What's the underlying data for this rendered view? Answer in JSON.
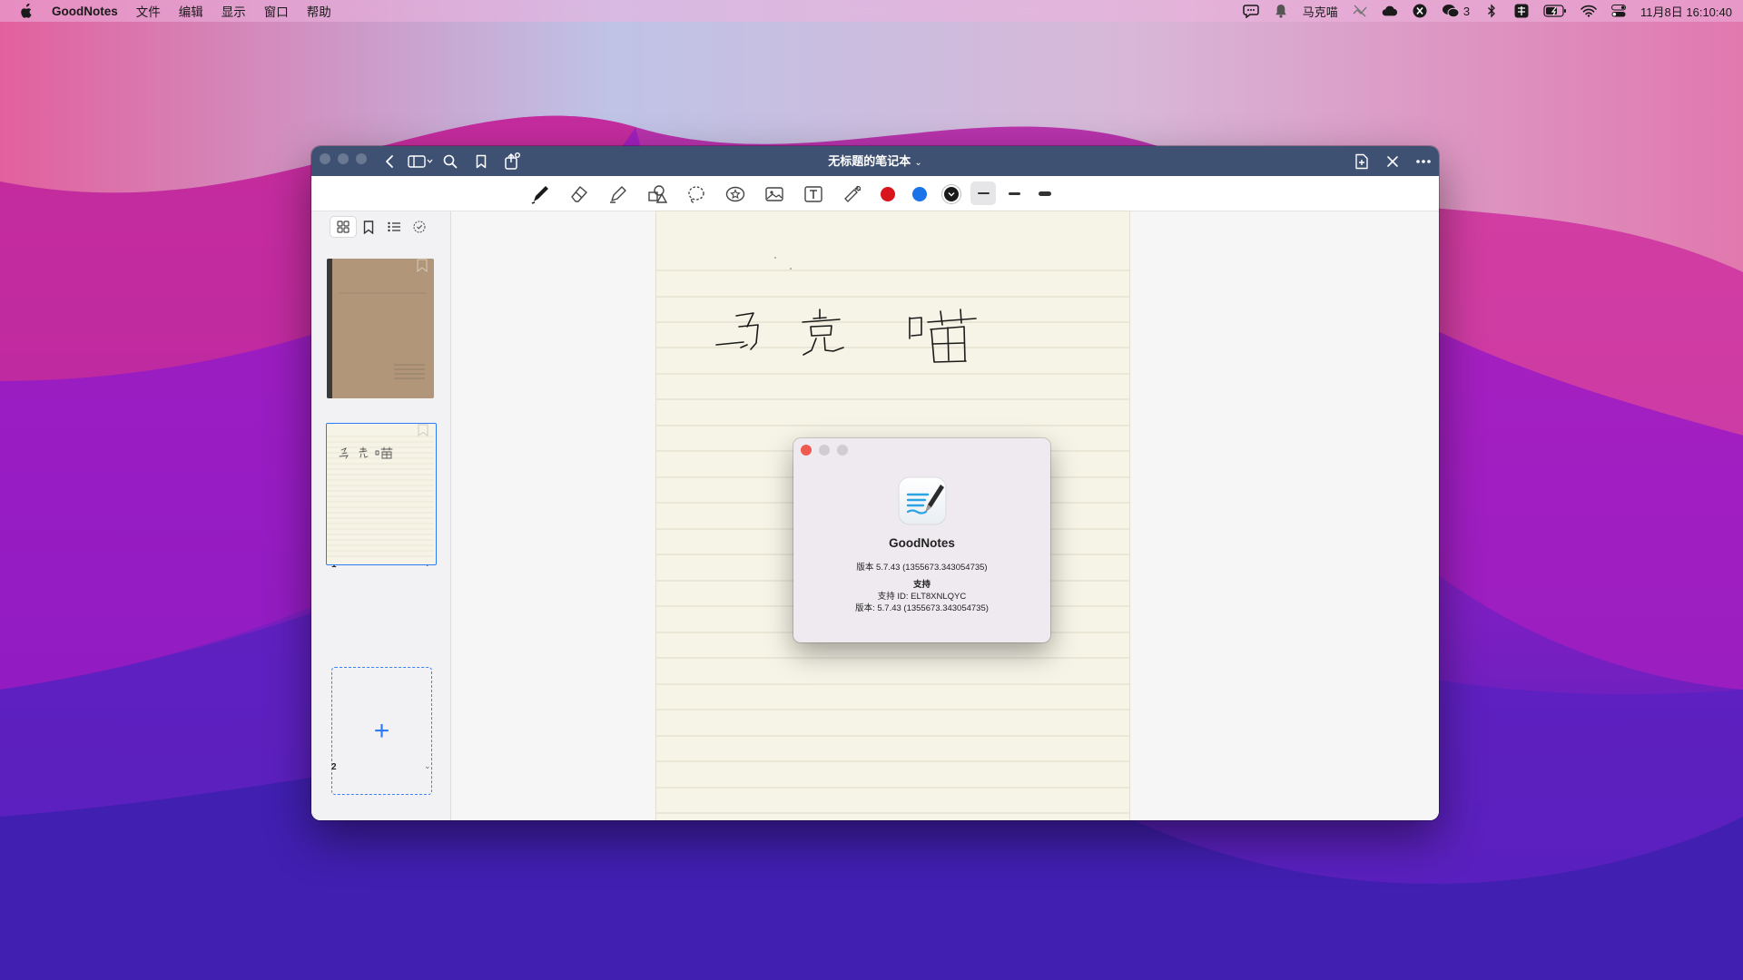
{
  "menubar": {
    "app_name": "GoodNotes",
    "menus": [
      "文件",
      "编辑",
      "显示",
      "窗口",
      "帮助"
    ],
    "user_name": "马克喵",
    "wechat_badge": "3",
    "datetime": "11月8日 16:10:40",
    "icons": [
      "apple-icon",
      "chat-bubble-icon",
      "bell-icon",
      "mute-icon",
      "cloud-icon",
      "x-icon",
      "wechat-icon",
      "bluetooth-icon",
      "input-method-icon",
      "battery-icon",
      "wifi-icon",
      "control-center-icon"
    ]
  },
  "window": {
    "title": "无标题的笔记本",
    "title_chevron": "⌄"
  },
  "toolbar": {
    "tools": [
      "pen",
      "eraser",
      "highlighter",
      "shapes",
      "lasso",
      "elements",
      "image",
      "text",
      "laser-pointer"
    ],
    "colors": [
      "#d8141c",
      "#1a73e8",
      "#1a1a1a"
    ],
    "selected_color": "#1a1a1a",
    "thickness_levels": [
      "thin",
      "medium",
      "thick"
    ],
    "selected_thickness": "thin"
  },
  "sidebar": {
    "view_modes": [
      "thumbnails",
      "bookmarks",
      "outline",
      "favorites"
    ],
    "selected_view": "thumbnails",
    "pages": [
      {
        "number": "1",
        "type": "cover",
        "chevron": "⌄"
      },
      {
        "number": "2",
        "type": "lined",
        "selected": true,
        "chevron": "⌄"
      }
    ],
    "add_page_symbol": "+"
  },
  "about_dialog": {
    "app_name": "GoodNotes",
    "version_line": "版本 5.7.43 (1355673.343054735)",
    "support_header": "支持",
    "support_id": "支持 ID: ELT8XNLQYC",
    "support_version": "版本: 5.7.43 (1355673.343054735)"
  },
  "colors": {
    "titlebar": "#3f5173",
    "accent": "#2f7bf5",
    "paper": "#f6f4e6",
    "cover": "#b1967a"
  }
}
